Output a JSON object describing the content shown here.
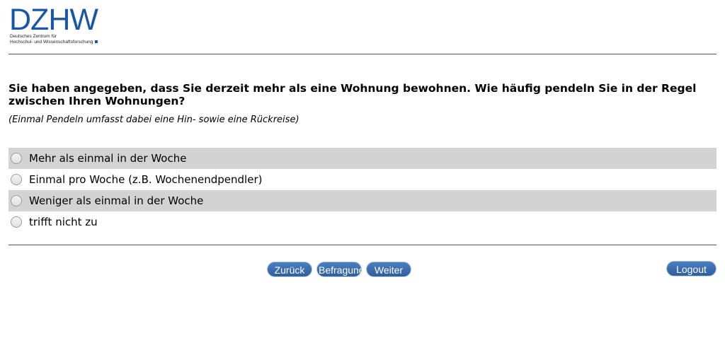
{
  "logo": {
    "word": "DZHW",
    "line1": "Deutsches Zentrum für",
    "line2": "Hochschul- und Wissenschaftsforschung",
    "brand_color": "#1a56a8"
  },
  "question": {
    "text": "Sie haben angegeben, dass Sie derzeit mehr als eine Wohnung bewohnen. Wie häufig pendeln Sie in der Regel zwischen Ihren Wohnungen?",
    "hint": "(Einmal Pendeln umfasst dabei eine Hin- sowie eine Rückreise)"
  },
  "options": [
    {
      "label": "Mehr als einmal in der Woche",
      "selected": false
    },
    {
      "label": "Einmal pro Woche (z.B. Wochenendpendler)",
      "selected": false
    },
    {
      "label": "Weniger als einmal in der Woche",
      "selected": false
    },
    {
      "label": "trifft nicht zu",
      "selected": false
    }
  ],
  "nav": {
    "back_label": "Zurück",
    "survey_label": "Befragung",
    "next_label": "Weiter",
    "logout_label": "Logout"
  },
  "colors": {
    "button": "#2e5e9e",
    "row_shade": "#d3d3d3"
  }
}
